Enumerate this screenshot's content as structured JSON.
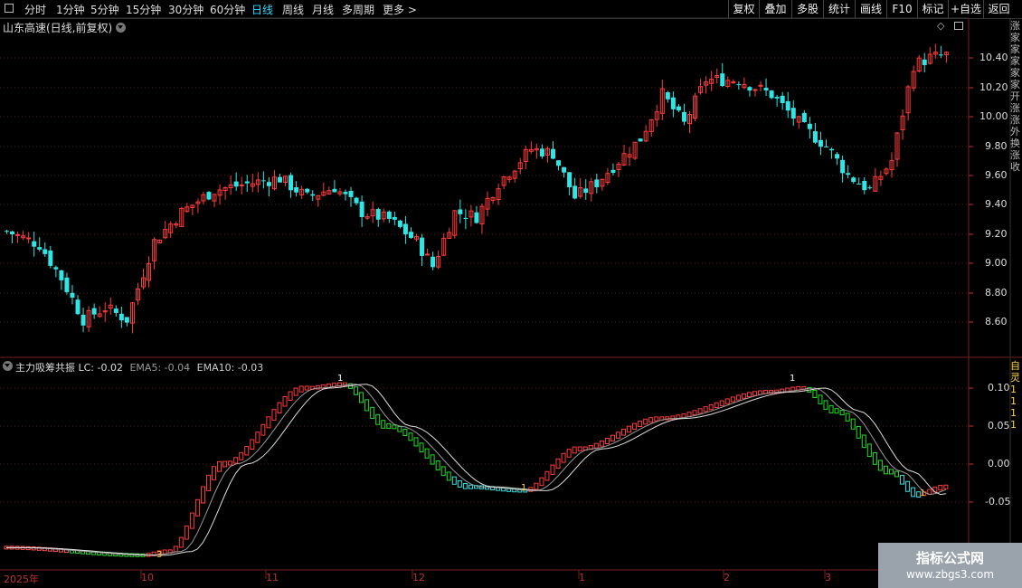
{
  "toolbar": {
    "timeframes": [
      "分时",
      "1分钟",
      "5分钟",
      "15分钟",
      "30分钟",
      "60分钟",
      "日线",
      "周线",
      "月线",
      "多周期",
      "更多 >"
    ],
    "active_timeframe": "日线",
    "buttons": [
      "复权",
      "叠加",
      "多股",
      "统计",
      "画线",
      "F10",
      "标记",
      "+自选",
      "返回"
    ]
  },
  "main_chart": {
    "title": "山东高速(日线,前复权)",
    "y_ticks": [
      "10.40",
      "10.20",
      "10.00",
      "9.80",
      "9.60",
      "9.40",
      "9.20",
      "9.00",
      "8.80",
      "8.60"
    ]
  },
  "indicator": {
    "name": "主力吸筹共振",
    "lc": "LC: -0.02",
    "ema5": "EMA5: -0.04",
    "ema10": "EMA10: -0.03",
    "y_ticks": [
      "0.10",
      "0.05",
      "0.00",
      "-0.05"
    ],
    "signals": [
      "3",
      "1",
      "1",
      "1",
      "1"
    ]
  },
  "x_axis": {
    "labels": [
      "2025年",
      "10",
      "11",
      "12",
      "1",
      "2",
      "3"
    ]
  },
  "right_strip": {
    "text": "涨家家家家家开涨涨外换涨收",
    "bottom_text": "自灵1111"
  },
  "watermark": {
    "line1": "指标公式网",
    "line2": "www.zbgs3.com"
  },
  "colors": {
    "up": "#ff3b3b",
    "down": "#2ee6e6",
    "green": "#22dd22",
    "grid": "#5a1a1a",
    "active": "#2ad8ff"
  }
}
